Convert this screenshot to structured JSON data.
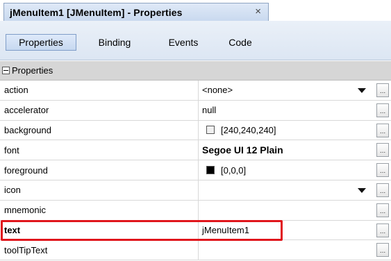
{
  "title": {
    "text": "jMenuItem1 [JMenuItem] - Properties",
    "close_icon": "×"
  },
  "tabs": [
    {
      "label": "Properties",
      "active": true
    },
    {
      "label": "Binding",
      "active": false
    },
    {
      "label": "Events",
      "active": false
    },
    {
      "label": "Code",
      "active": false
    }
  ],
  "section": {
    "label": "Properties",
    "icon": "collapse-box-icon"
  },
  "rows": [
    {
      "name": "action",
      "value": "<none>",
      "dropdown": true
    },
    {
      "name": "accelerator",
      "value": "null"
    },
    {
      "name": "background",
      "value": "[240,240,240]",
      "swatch": "#f0f0f0"
    },
    {
      "name": "font",
      "value": "Segoe UI 12 Plain"
    },
    {
      "name": "foreground",
      "value": "[0,0,0]",
      "swatch": "#000000"
    },
    {
      "name": "icon",
      "value": "",
      "dropdown": true
    },
    {
      "name": "mnemonic",
      "value": ""
    },
    {
      "name": "text",
      "value": "jMenuItem1"
    },
    {
      "name": "toolTipText",
      "value": ""
    }
  ],
  "ellipsis_label": "...",
  "colors": {
    "highlight": "#e0161c",
    "section_bg": "#d6d6d6",
    "tab_active": "#c6d8f0"
  }
}
